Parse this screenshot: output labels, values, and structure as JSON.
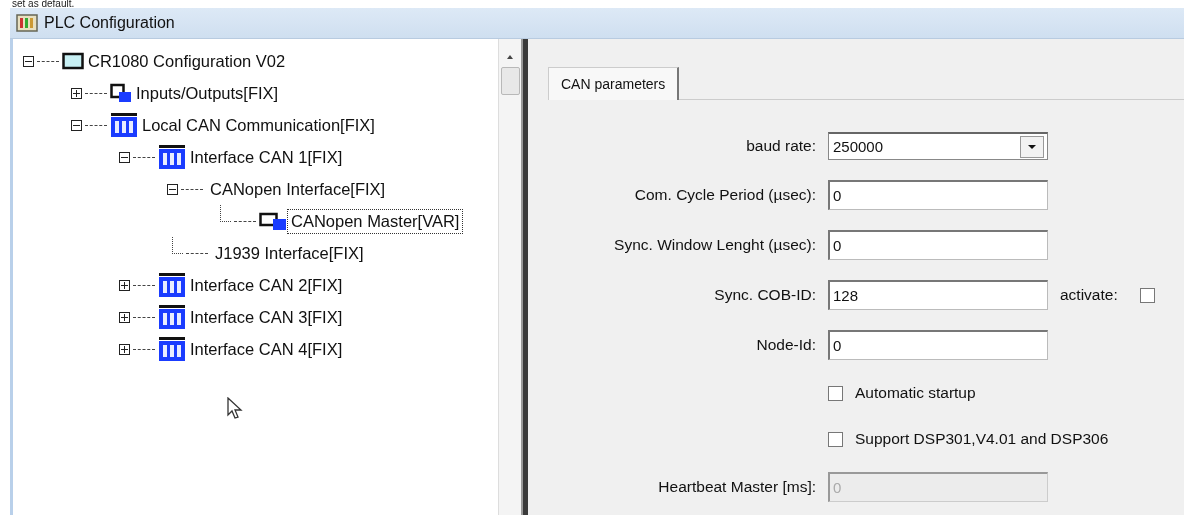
{
  "caption": "set as default.",
  "window": {
    "title": "PLC Configuration"
  },
  "tree": [
    {
      "label": "CR1080 Configuration V02",
      "kind": "screen",
      "expanded": true,
      "selected": false,
      "children": [
        {
          "label": "Inputs/Outputs[FIX]",
          "kind": "io",
          "expanded": false,
          "selected": false
        },
        {
          "label": "Local CAN Communication[FIX]",
          "kind": "can",
          "expanded": true,
          "selected": false,
          "children": [
            {
              "label": "Interface CAN 1[FIX]",
              "kind": "can",
              "expanded": true,
              "selected": false,
              "children": [
                {
                  "label": "CANopen Interface[FIX]",
                  "expanded": true,
                  "selected": false,
                  "children": [
                    {
                      "label": "CANopen Master[VAR]",
                      "kind": "master",
                      "selected": true
                    }
                  ]
                },
                {
                  "label": "J1939 Interface[FIX]",
                  "selected": false
                }
              ]
            },
            {
              "label": "Interface CAN 2[FIX]",
              "kind": "can",
              "expanded": false,
              "selected": false
            },
            {
              "label": "Interface CAN 3[FIX]",
              "kind": "can",
              "expanded": false,
              "selected": false
            },
            {
              "label": "Interface CAN 4[FIX]",
              "kind": "can",
              "expanded": false,
              "selected": false
            }
          ]
        }
      ]
    }
  ],
  "tabs": [
    {
      "label": "CAN parameters",
      "selected": true
    }
  ],
  "fields": [
    {
      "kind": "dropdown",
      "label": "baud rate:",
      "value": "250000"
    },
    {
      "kind": "text",
      "label": "Com. Cycle Period (µsec):",
      "value": "0",
      "disabled": false
    },
    {
      "kind": "text",
      "label": "Sync. Window Lenght (µsec):",
      "value": "0",
      "disabled": false
    },
    {
      "kind": "text",
      "label": "Sync. COB-ID:",
      "value": "128",
      "disabled": false,
      "extra": {
        "label": "activate:",
        "checked": false
      }
    },
    {
      "kind": "text",
      "label": "Node-Id:",
      "value": "0",
      "disabled": false
    },
    {
      "kind": "checkbox",
      "label": "Automatic startup",
      "checked": false
    },
    {
      "kind": "checkbox",
      "label": "Support DSP301,V4.01 and DSP306",
      "checked": false
    },
    {
      "kind": "text",
      "label": "Heartbeat Master [ms]:",
      "value": "0",
      "disabled": true
    }
  ]
}
